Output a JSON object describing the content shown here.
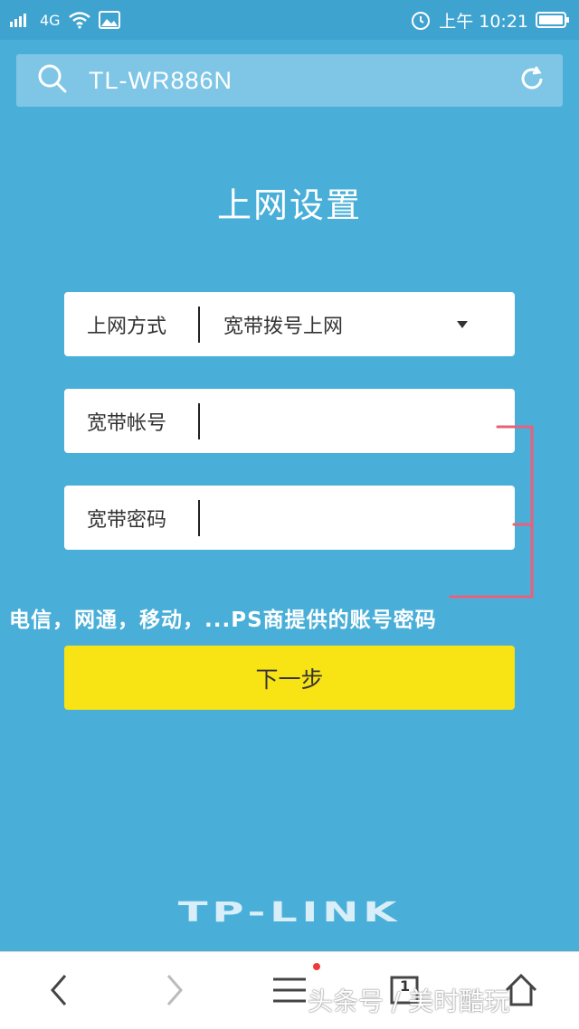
{
  "status_bar": {
    "network": "4G",
    "time": "上午 10:21"
  },
  "url_bar": {
    "text": "TL-WR886N"
  },
  "page": {
    "title": "上网设置",
    "connection_type": {
      "label": "上网方式",
      "value": "宽带拨号上网"
    },
    "account": {
      "label": "宽带帐号",
      "value": ""
    },
    "password": {
      "label": "宽带密码",
      "value": ""
    },
    "annotation": "电信，网通，移动，...PS商提供的账号密码",
    "annotation_color": "#e8607a",
    "next_button": "下一步",
    "logo": "TP-LINK"
  },
  "bottom_nav": {
    "tab_count": "1",
    "watermark": "头条号 / 美时酷玩"
  },
  "colors": {
    "background": "#4aafd8",
    "button": "#f8e315"
  }
}
